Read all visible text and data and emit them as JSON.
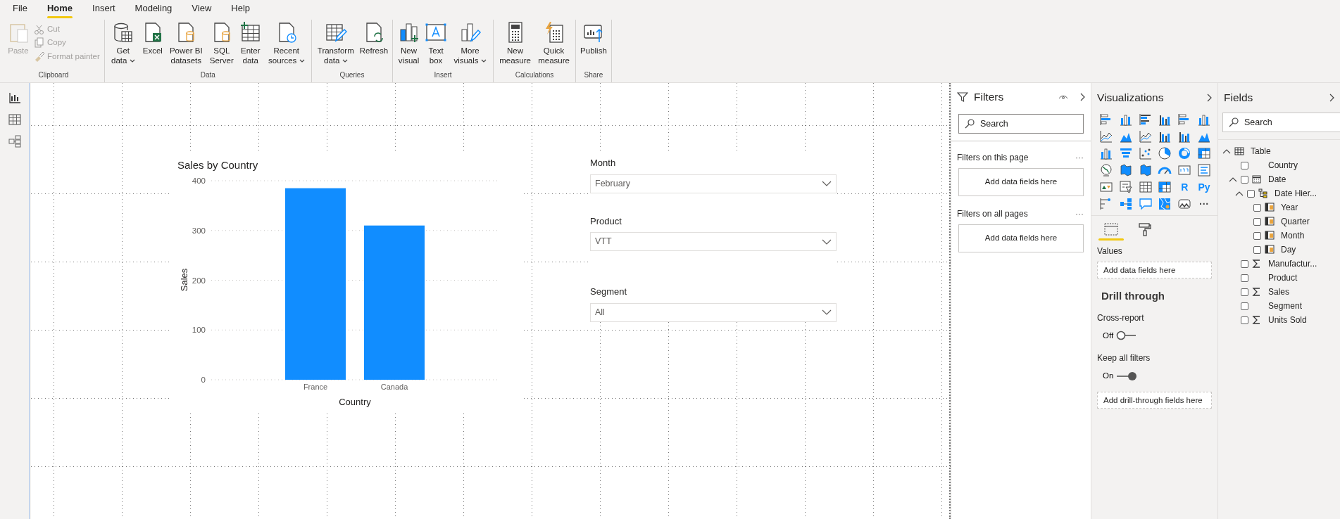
{
  "ribbon": {
    "tabs": [
      {
        "label": "File",
        "selected": false
      },
      {
        "label": "Home",
        "selected": true
      },
      {
        "label": "Insert",
        "selected": false
      },
      {
        "label": "Modeling",
        "selected": false
      },
      {
        "label": "View",
        "selected": false
      },
      {
        "label": "Help",
        "selected": false
      }
    ],
    "groups": [
      {
        "label": "Clipboard",
        "buttons": [
          {
            "kind": "large",
            "label": "Paste",
            "dropdown": false,
            "disabled": true
          },
          {
            "kind": "small",
            "label": "Cut",
            "dropdown": false,
            "disabled": true
          },
          {
            "kind": "small",
            "label": "Copy",
            "dropdown": false,
            "disabled": true
          },
          {
            "kind": "small",
            "label": "Format painter",
            "dropdown": false,
            "disabled": true
          }
        ]
      },
      {
        "label": "Data",
        "buttons": [
          {
            "kind": "large",
            "label": "Get data",
            "dropdown": true,
            "disabled": false
          },
          {
            "kind": "large",
            "label": "Excel",
            "dropdown": false,
            "disabled": false
          },
          {
            "kind": "large",
            "label": "Power BI datasets",
            "dropdown": false,
            "disabled": false
          },
          {
            "kind": "large",
            "label": "SQL Server",
            "dropdown": false,
            "disabled": false
          },
          {
            "kind": "large",
            "label": "Enter data",
            "dropdown": false,
            "disabled": false
          },
          {
            "kind": "large",
            "label": "Recent sources",
            "dropdown": true,
            "disabled": false
          }
        ]
      },
      {
        "label": "Queries",
        "buttons": [
          {
            "kind": "large",
            "label": "Transform data",
            "dropdown": true,
            "disabled": false
          },
          {
            "kind": "large",
            "label": "Refresh",
            "dropdown": false,
            "disabled": false
          }
        ]
      },
      {
        "label": "Insert",
        "buttons": [
          {
            "kind": "large",
            "label": "New visual",
            "dropdown": false,
            "disabled": false
          },
          {
            "kind": "large",
            "label": "Text box",
            "dropdown": false,
            "disabled": false
          },
          {
            "kind": "large",
            "label": "More visuals",
            "dropdown": true,
            "disabled": false
          }
        ]
      },
      {
        "label": "Calculations",
        "buttons": [
          {
            "kind": "large",
            "label": "New measure",
            "dropdown": false,
            "disabled": false
          },
          {
            "kind": "large",
            "label": "Quick measure",
            "dropdown": false,
            "disabled": false
          }
        ]
      },
      {
        "label": "Share",
        "buttons": [
          {
            "kind": "large",
            "label": "Publish",
            "dropdown": false,
            "disabled": false
          }
        ]
      }
    ]
  },
  "report": {
    "chart": {
      "title": "Sales by Country",
      "chart_data": {
        "type": "bar",
        "xlabel": "Country",
        "grid": true,
        "categories": [
          "France",
          "Canada"
        ],
        "series": [
          {
            "name": "Sales",
            "color": "#118dff",
            "values": [
              385,
              310
            ]
          }
        ],
        "ylim": [
          0,
          400
        ],
        "yticks": [
          0,
          100,
          200,
          300,
          400
        ]
      }
    },
    "slicers": [
      {
        "label": "Month",
        "value": "February"
      },
      {
        "label": "Product",
        "value": "VTT"
      },
      {
        "label": "Segment",
        "value": "All"
      }
    ]
  },
  "filters": {
    "title": "Filters",
    "search": {
      "placeholder": "Search"
    },
    "sections": [
      {
        "label": "Filters on this page",
        "more": "···",
        "drop_zone": "Add data fields here"
      },
      {
        "label": "Filters on all pages",
        "more": "···",
        "drop_zone": "Add data fields here"
      }
    ]
  },
  "visualizations": {
    "title": "Visualizations",
    "gallery_texts": [
      "R",
      "Py",
      "···"
    ],
    "tabs": [
      {
        "kind": "fields",
        "selected": true
      },
      {
        "kind": "format",
        "selected": false
      }
    ],
    "values_label": "Values",
    "values_drop_zone": "Add data fields here",
    "drill_through": {
      "title": "Drill through",
      "options": [
        {
          "label": "Cross-report",
          "state_text": "Off",
          "on": false
        },
        {
          "label": "Keep all filters",
          "state_text": "On",
          "on": true
        }
      ],
      "drop_zone": "Add drill-through fields here"
    }
  },
  "fields": {
    "title": "Fields",
    "search": {
      "placeholder": "Search"
    },
    "tree": [
      {
        "kind": "table",
        "label": "Table",
        "expanded": true,
        "children": [
          {
            "kind": "text",
            "label": "Country",
            "checked": false
          },
          {
            "kind": "date",
            "label": "Date",
            "checked": false,
            "expanded": true,
            "children": [
              {
                "kind": "hierarchy",
                "label": "Date Hier...",
                "checked": false,
                "expanded": true,
                "children": [
                  {
                    "kind": "level",
                    "label": "Year",
                    "checked": false
                  },
                  {
                    "kind": "level",
                    "label": "Quarter",
                    "checked": false
                  },
                  {
                    "kind": "level",
                    "label": "Month",
                    "checked": false
                  },
                  {
                    "kind": "level",
                    "label": "Day",
                    "checked": false
                  }
                ]
              }
            ]
          },
          {
            "kind": "measure",
            "label": "Manufactur...",
            "checked": false
          },
          {
            "kind": "text",
            "label": "Product",
            "checked": false
          },
          {
            "kind": "measure",
            "label": "Sales",
            "checked": false
          },
          {
            "kind": "text",
            "label": "Segment",
            "checked": false
          },
          {
            "kind": "measure",
            "label": "Units Sold",
            "checked": false
          }
        ]
      }
    ]
  }
}
